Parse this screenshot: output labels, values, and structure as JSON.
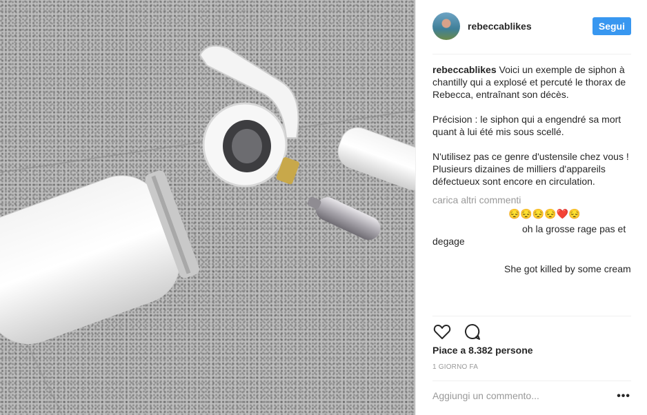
{
  "post": {
    "username": "rebeccablikes",
    "follow_label": "Segui"
  },
  "caption": {
    "username": "rebeccablikes",
    "paragraphs": [
      "Voici un exemple de siphon à chantilly qui a explosé et percuté le thorax de Rebecca, entraînant son décès.",
      "Précision : le siphon qui a engendré sa mort quant à lui été mis sous scellé.",
      "N'utilisez pas ce genre d'ustensile chez vous ! Plusieurs dizaines de milliers d'appareils défectueux sont encore en circulation."
    ]
  },
  "load_more": "carica altri commenti",
  "comments": [
    {
      "text": "😔😔😔😔❤️😔"
    },
    {
      "text": "oh la grosse rage pas et degage"
    },
    {
      "text": "She got killed by some cream"
    }
  ],
  "actions": {
    "like_icon": "heart-icon",
    "comment_icon": "comment-icon"
  },
  "likes_text": "Piace a 8.382 persone",
  "time_text": "1 GIORNO FA",
  "add_comment_placeholder": "Aggiungi un commento...",
  "more_options": "•••",
  "colors": {
    "follow_button": "#3897f0",
    "meta_text": "#999999",
    "divider": "#efefef"
  }
}
